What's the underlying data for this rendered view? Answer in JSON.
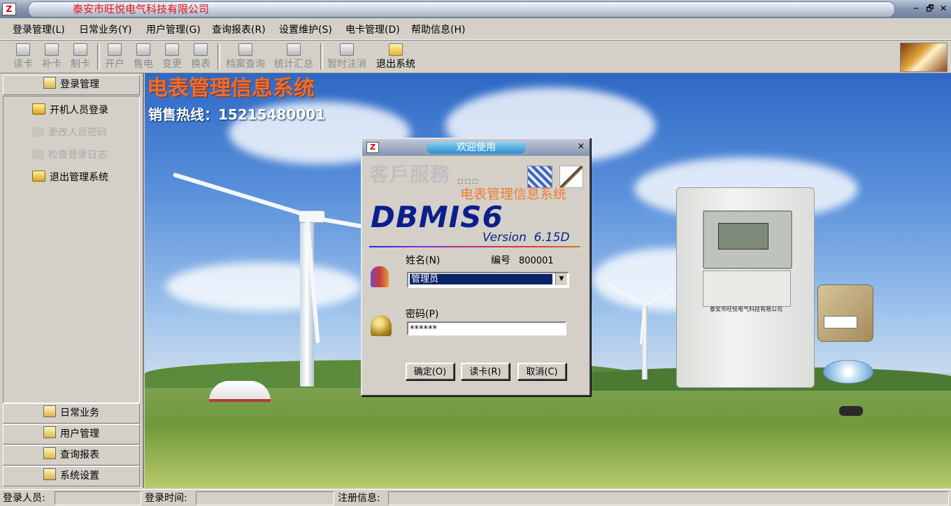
{
  "window": {
    "title": "泰安市旺悦电气科技有限公司",
    "controls": [
      "─",
      "🗗",
      "✕"
    ]
  },
  "menu": [
    {
      "label": "登录管理(L)"
    },
    {
      "label": "日常业务(Y)"
    },
    {
      "label": "用户管理(G)"
    },
    {
      "label": "查询报表(R)"
    },
    {
      "label": "设置维护(S)"
    },
    {
      "label": "电卡管理(D)"
    },
    {
      "label": "帮助信息(H)"
    }
  ],
  "toolbar": {
    "read_card": "读卡",
    "reissue_card": "补卡",
    "make_card": "制卡",
    "open_account": "开户",
    "sell_power": "售电",
    "change": "变更",
    "replace_meter": "换表",
    "archive_query": "档案查询",
    "statistics": "统计汇总",
    "pause_logout": "暂时注消",
    "exit_system": "退出系统"
  },
  "sidebar": {
    "active_section": "登录管理",
    "items": [
      {
        "label": "开机人员登录",
        "enabled": true
      },
      {
        "label": "更改人员密码",
        "enabled": false
      },
      {
        "label": "检查登录日志",
        "enabled": false
      },
      {
        "label": "退出管理系统",
        "enabled": true
      }
    ],
    "sections": [
      "日常业务",
      "用户管理",
      "查询报表",
      "系统设置"
    ]
  },
  "main": {
    "title": "电表管理信息系统",
    "hotline": "销售热线：15215480001",
    "meter_company": "泰安市旺悦电气科技有限公司"
  },
  "dialog": {
    "title": "欢迎使用",
    "close": "×",
    "service": "客戶服務",
    "service_boxes": "□□□",
    "system_name": "电表管理信息系统",
    "product": "DBMIS6",
    "version": "Version  6.15D",
    "name_label": "姓名(N)",
    "code_label": "编号",
    "code_value": "800001",
    "user_value": "管理员",
    "dropdown_arrow": "▼",
    "password_label": "密码(P)",
    "password_value": "******",
    "buttons": {
      "confirm": "确定(O)",
      "read_card": "读卡(R)",
      "cancel": "取消(C)"
    }
  },
  "status": {
    "user_label": "登录人员:",
    "time_label": "登录时间:",
    "reg_label": "注册信息:"
  },
  "colors": {
    "app_title": "#e8141b",
    "main_title": "#ef6c2c",
    "product": "#0b1f8c",
    "selection": "#0a246a"
  }
}
